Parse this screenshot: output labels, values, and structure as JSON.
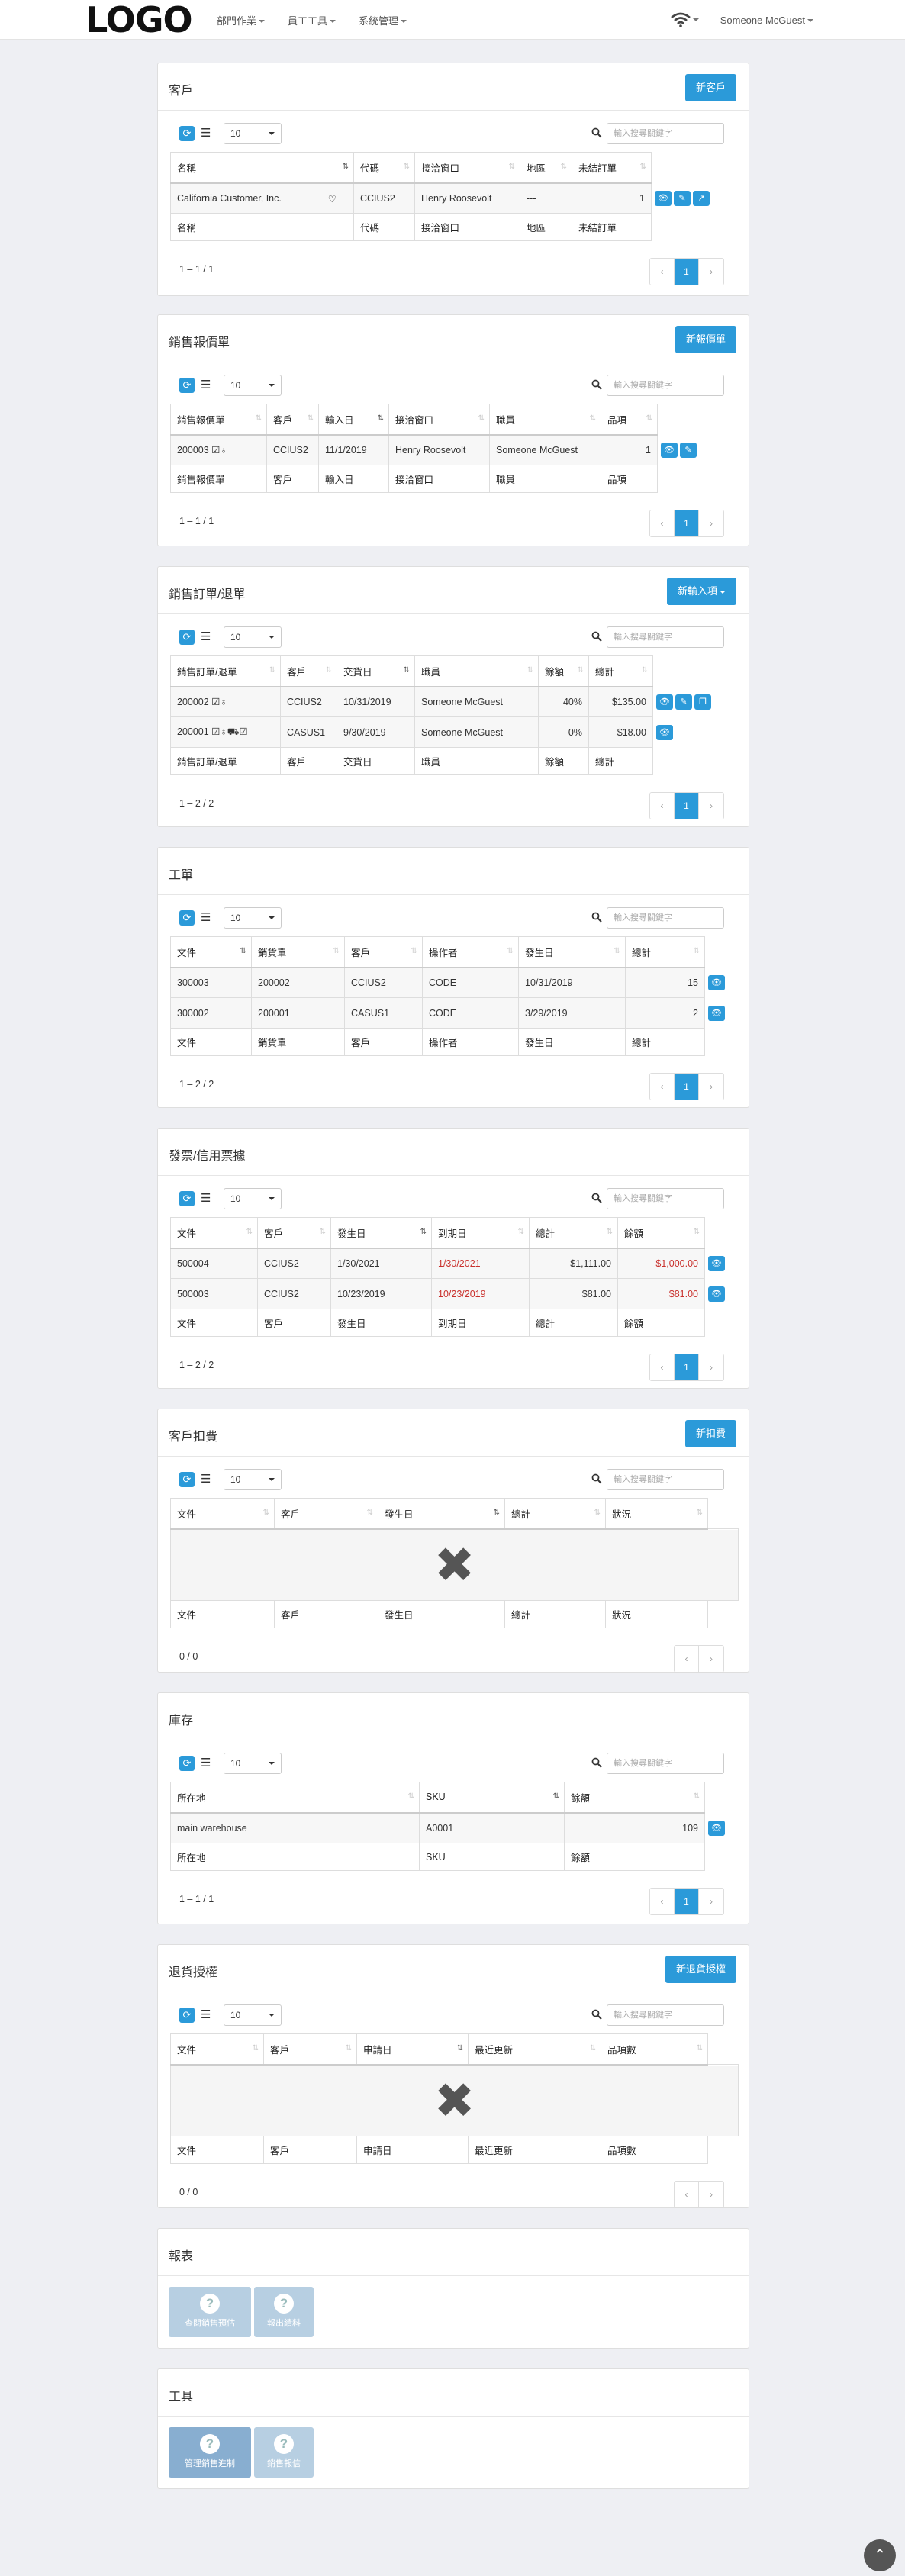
{
  "nav": {
    "logo": "LOGO",
    "menus": [
      "部門作業",
      "員工工具",
      "系統管理"
    ],
    "user": "Someone McGuest"
  },
  "colors": {
    "accent": "#2b9ad9",
    "background": "#eeeff3",
    "danger": "#c9302c"
  },
  "common": {
    "page_size": "10",
    "search_placeholder": "輸入搜尋關鍵字"
  },
  "customers": {
    "title": "客戶",
    "new_button": "新客戶",
    "columns": [
      "名稱",
      "代碼",
      "接洽窗口",
      "地區",
      "未結訂單"
    ],
    "rows": [
      [
        "California Customer, Inc.",
        "CCIUS2",
        "Henry Roosevolt",
        "---",
        "1"
      ]
    ],
    "count": "1 – 1 / 1",
    "page": "1"
  },
  "quotes": {
    "title": "銷售報價單",
    "new_button": "新報價單",
    "columns": [
      "銷售報價單",
      "客戶",
      "輸入日",
      "接洽窗口",
      "職員",
      "品項"
    ],
    "rows": [
      [
        "200003",
        "CCIUS2",
        "11/1/2019",
        "Henry Roosevolt",
        "Someone McGuest",
        "1"
      ]
    ],
    "count": "1 – 1 / 1",
    "page": "1"
  },
  "orders": {
    "title": "銷售訂單/退單",
    "new_button": "新輸入項",
    "columns": [
      "銷售訂單/退單",
      "客戶",
      "交貨日",
      "職員",
      "餘額",
      "總計"
    ],
    "rows": [
      [
        "200002",
        "CCIUS2",
        "10/31/2019",
        "Someone McGuest",
        "40%",
        "$135.00"
      ],
      [
        "200001",
        "CASUS1",
        "9/30/2019",
        "Someone McGuest",
        "0%",
        "$18.00"
      ]
    ],
    "count": "1 – 2 / 2",
    "page": "1"
  },
  "workorders": {
    "title": "工單",
    "columns": [
      "文件",
      "銷貨單",
      "客戶",
      "操作者",
      "發生日",
      "總計"
    ],
    "rows": [
      [
        "300003",
        "200002",
        "CCIUS2",
        "CODE",
        "10/31/2019",
        "15"
      ],
      [
        "300002",
        "200001",
        "CASUS1",
        "CODE",
        "3/29/2019",
        "2"
      ]
    ],
    "count": "1 – 2 / 2",
    "page": "1"
  },
  "invoices": {
    "title": "發票/信用票據",
    "columns": [
      "文件",
      "客戶",
      "發生日",
      "到期日",
      "總計",
      "餘額"
    ],
    "rows": [
      [
        "500004",
        "CCIUS2",
        "1/30/2021",
        "1/30/2021",
        "$1,111.00",
        "$1,000.00"
      ],
      [
        "500003",
        "CCIUS2",
        "10/23/2019",
        "10/23/2019",
        "$81.00",
        "$81.00"
      ]
    ],
    "count": "1 – 2 / 2",
    "page": "1"
  },
  "charges": {
    "title": "客戶扣費",
    "new_button": "新扣費",
    "columns": [
      "文件",
      "客戶",
      "發生日",
      "總計",
      "狀況"
    ],
    "count": "0 / 0"
  },
  "inventory": {
    "title": "庫存",
    "columns": [
      "所在地",
      "SKU",
      "餘額"
    ],
    "rows": [
      [
        "main warehouse",
        "A0001",
        "109"
      ]
    ],
    "count": "1 – 1 / 1",
    "page": "1"
  },
  "returns": {
    "title": "退貨授權",
    "new_button": "新退貨授權",
    "columns": [
      "文件",
      "客戶",
      "申請日",
      "最近更新",
      "品項數"
    ],
    "count": "0 / 0"
  },
  "reports": {
    "title": "報表",
    "tiles": [
      "查閱銷售預估",
      "報出績料"
    ]
  },
  "tools": {
    "title": "工具",
    "tiles": [
      "管理銷售進制",
      "銷售報信"
    ]
  }
}
